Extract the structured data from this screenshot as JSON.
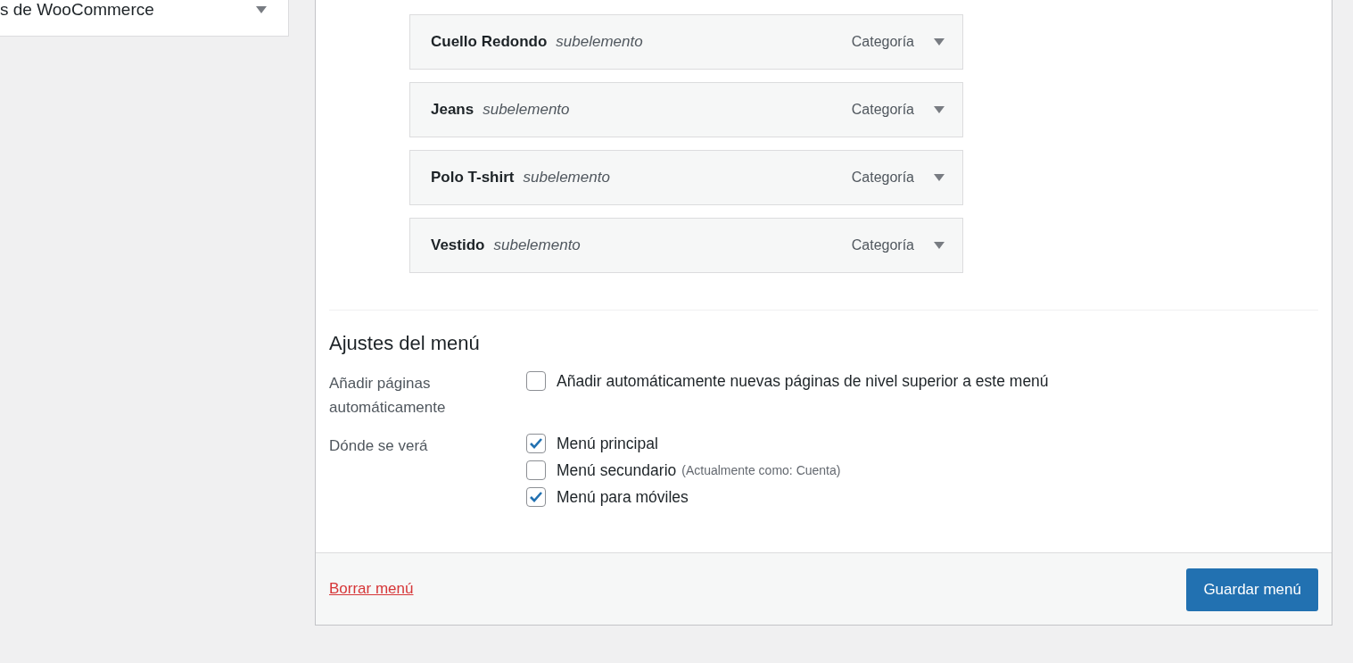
{
  "side_panel": {
    "title": "s de WooCommerce",
    "expanded": false
  },
  "menu_items": [
    {
      "title": "Cuello Redondo",
      "note": "subelemento",
      "type": "Categoría",
      "expanded": false
    },
    {
      "title": "Jeans",
      "note": "subelemento",
      "type": "Categoría",
      "expanded": false
    },
    {
      "title": "Polo T-shirt",
      "note": "subelemento",
      "type": "Categoría",
      "expanded": false
    },
    {
      "title": "Vestido",
      "note": "subelemento",
      "type": "Categoría",
      "expanded": false
    }
  ],
  "settings": {
    "heading": "Ajustes del menú",
    "groups": [
      {
        "label": "Añadir páginas automáticamente",
        "options": [
          {
            "label": "Añadir automáticamente nuevas páginas de nivel superior a este menú",
            "checked": false
          }
        ]
      },
      {
        "label": "Dónde se verá",
        "options": [
          {
            "label": "Menú principal",
            "checked": true
          },
          {
            "label": "Menú secundario",
            "note": "(Actualmente como: Cuenta)",
            "checked": false
          },
          {
            "label": "Menú para móviles",
            "checked": true
          }
        ]
      }
    ]
  },
  "footer": {
    "delete_link": "Borrar menú",
    "save_button": "Guardar menú"
  }
}
